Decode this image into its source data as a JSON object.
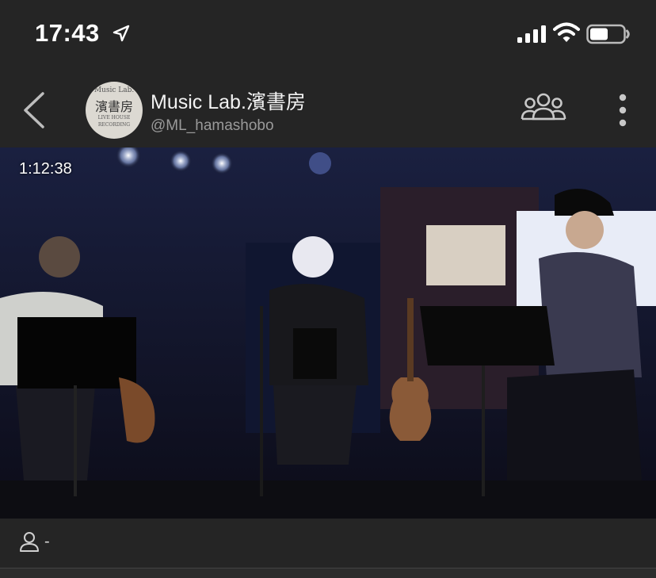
{
  "status_bar": {
    "time": "17:43",
    "icons": [
      "location-arrow-icon",
      "cellular-signal-icon",
      "wifi-icon",
      "battery-icon"
    ]
  },
  "header": {
    "back_icon": "chevron-left-icon",
    "avatar_logo": {
      "line1": "Music Lab.",
      "line2": "濱書房",
      "line3": "LIVE HOUSE",
      "line4": "RECORDING"
    },
    "channel_name": "Music Lab.濱書房",
    "channel_handle": "@ML_hamashobo",
    "group_icon": "group-people-icon",
    "more_icon": "vertical-ellipsis-icon"
  },
  "video": {
    "elapsed_time": "1:12:38"
  },
  "footer": {
    "viewer_icon": "person-outline-icon",
    "viewer_count": "-"
  },
  "colors": {
    "background": "#252525",
    "video_bg": "#0a0a12",
    "text_primary": "#f2f2f2",
    "text_secondary": "#9a9a9a"
  }
}
